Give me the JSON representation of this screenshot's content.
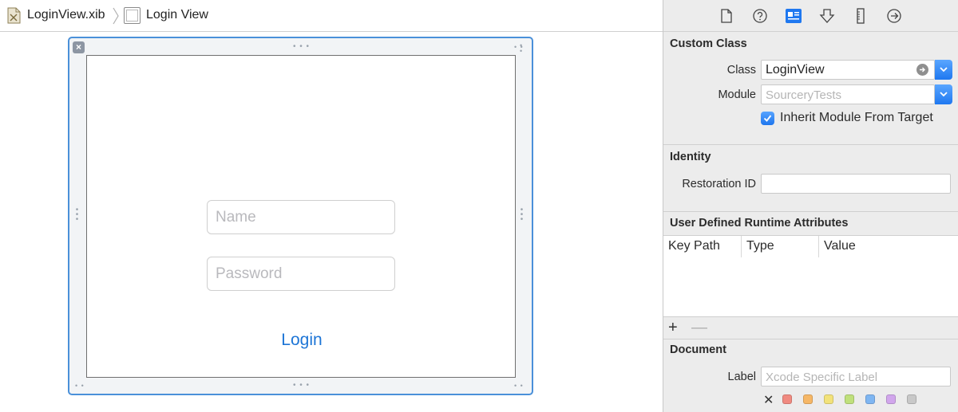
{
  "breadcrumb": {
    "file": "LoginView.xib",
    "view": "Login View",
    "file_icon": "xib-file-icon",
    "view_icon": "view-icon"
  },
  "canvas": {
    "name_placeholder": "Name",
    "password_placeholder": "Password",
    "login_label": "Login",
    "colors": {
      "selection": "#4a90d9",
      "link": "#1d75d6"
    }
  },
  "inspector": {
    "tabs": [
      "file-inspector-icon",
      "quick-help-icon",
      "identity-inspector-icon",
      "attributes-inspector-icon",
      "size-inspector-icon",
      "connections-inspector-icon"
    ],
    "custom_class": {
      "title": "Custom Class",
      "class_label": "Class",
      "class_value": "LoginView",
      "module_label": "Module",
      "module_placeholder": "SourceryTests",
      "inherit_label": "Inherit Module From Target",
      "inherit_checked": true
    },
    "identity": {
      "title": "Identity",
      "restoration_label": "Restoration ID",
      "restoration_value": ""
    },
    "runtime_attributes": {
      "title": "User Defined Runtime Attributes",
      "columns": [
        "Key Path",
        "Type",
        "Value"
      ],
      "add_label": "+",
      "remove_label": "—"
    },
    "document": {
      "title": "Document",
      "label_label": "Label",
      "label_placeholder": "Xcode Specific Label",
      "clear_label": "✕",
      "label_colors": [
        "#f08a80",
        "#f6b766",
        "#f2e27a",
        "#bfe07c",
        "#7fb6f2",
        "#d1a6ec",
        "#c8c8c8"
      ]
    }
  }
}
